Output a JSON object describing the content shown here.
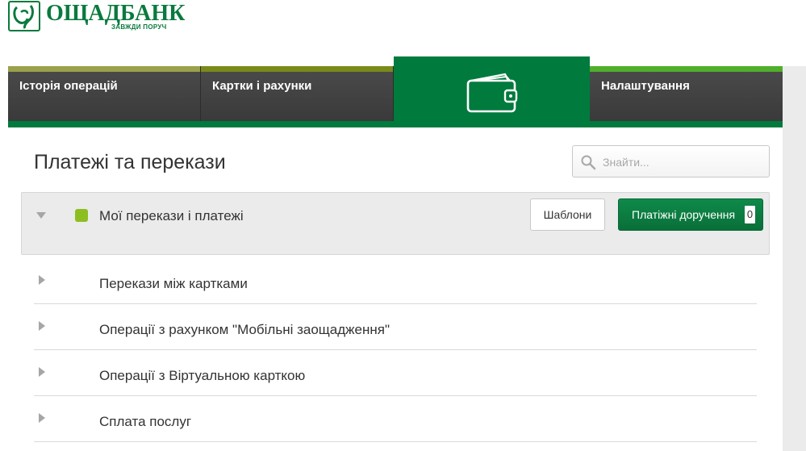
{
  "brand": {
    "name": "ОЩАДБАНК",
    "tagline": "ЗАВЖДИ ПОРУЧ",
    "color": "#0a7a3e"
  },
  "nav": {
    "items": [
      {
        "label": "Історія операцій"
      },
      {
        "label": "Картки і рахунки"
      },
      {
        "label": "",
        "icon": "wallet-icon",
        "active": true
      },
      {
        "label": "Налаштування"
      }
    ]
  },
  "main": {
    "title": "Платежі та перекази",
    "search": {
      "placeholder": "Знайти..."
    },
    "group": {
      "title": "Мої перекази і платежі",
      "templates_label": "Шаблони",
      "orders_label": "Платіжні доручення",
      "orders_count": "0"
    },
    "rows": [
      {
        "label": "Перекази між картками"
      },
      {
        "label": "Операції з рахунком \"Мобільні заощадження\""
      },
      {
        "label": "Операції з Віртуальною карткою"
      },
      {
        "label": "Сплата послуг"
      }
    ]
  }
}
